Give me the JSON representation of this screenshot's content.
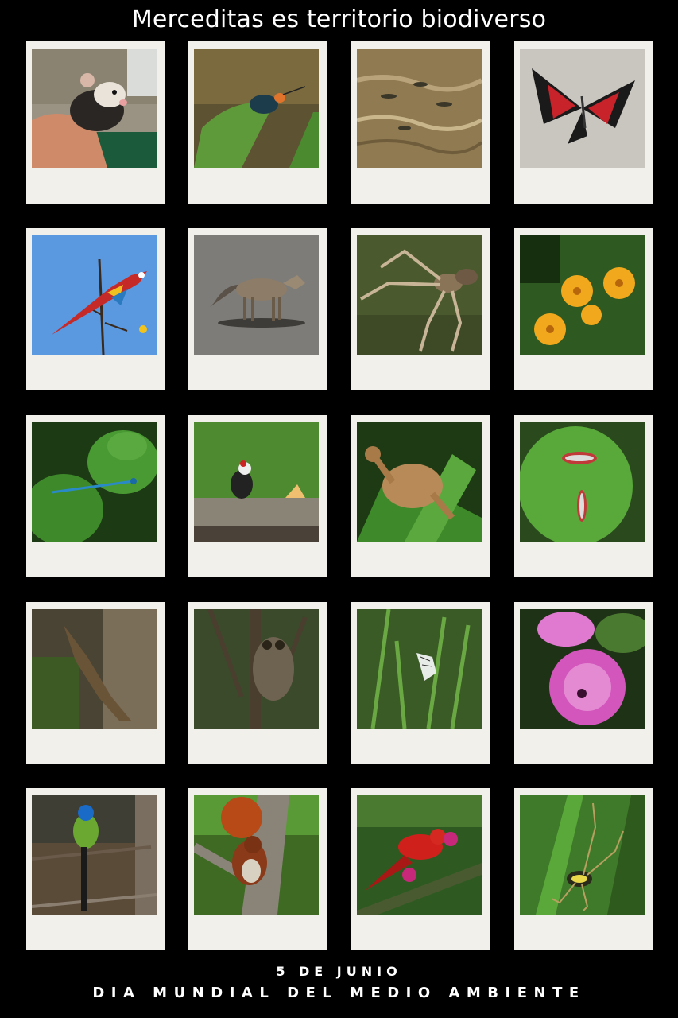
{
  "title": "Merceditas es territorio biodiverso",
  "footer": {
    "date": "5 DE JUNIO",
    "event": "DIA MUNDIAL DEL MEDIO AMBIENTE"
  },
  "photos": [
    {
      "subject": "opossum"
    },
    {
      "subject": "beetle"
    },
    {
      "subject": "fish"
    },
    {
      "subject": "butterfly"
    },
    {
      "subject": "macaw"
    },
    {
      "subject": "fox"
    },
    {
      "subject": "spider"
    },
    {
      "subject": "flowers"
    },
    {
      "subject": "damselfly"
    },
    {
      "subject": "woodpecker"
    },
    {
      "subject": "frog"
    },
    {
      "subject": "bugs"
    },
    {
      "subject": "lizard"
    },
    {
      "subject": "owl"
    },
    {
      "subject": "white-butterfly"
    },
    {
      "subject": "morning-glory"
    },
    {
      "subject": "motmot"
    },
    {
      "subject": "squirrel"
    },
    {
      "subject": "tanager"
    },
    {
      "subject": "orb-spider"
    }
  ]
}
